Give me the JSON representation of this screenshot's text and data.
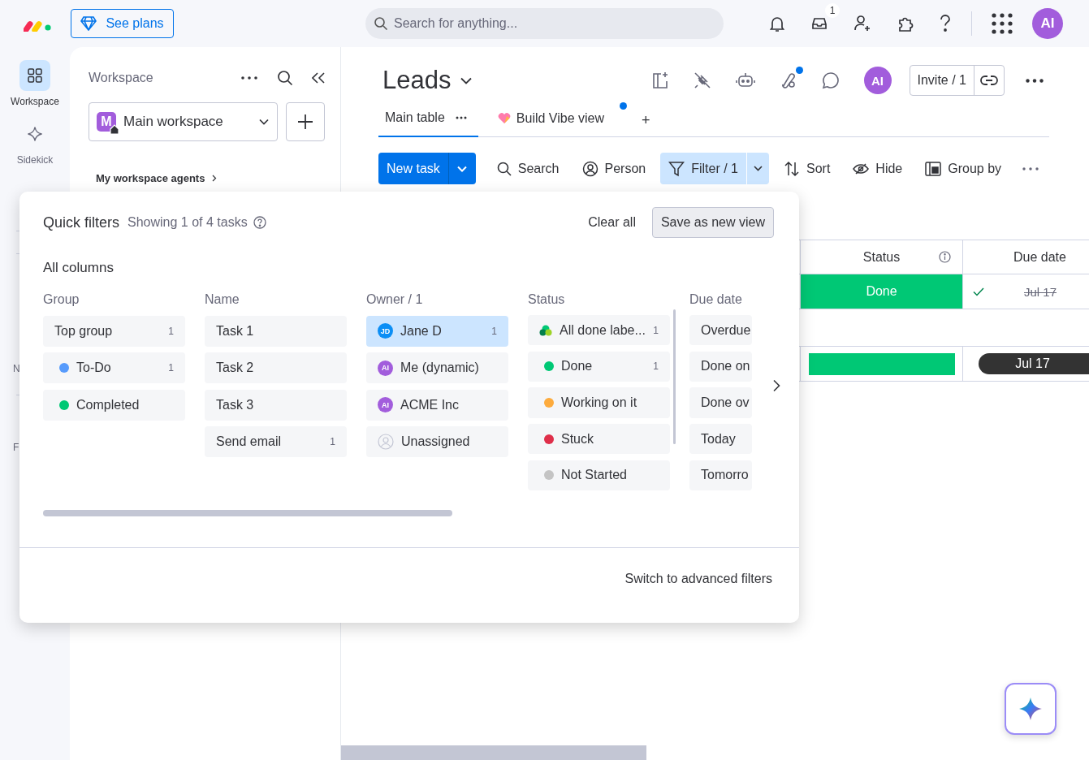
{
  "top_bar": {
    "plans_button": "See plans",
    "search": {
      "placeholder": "Search for anything..."
    },
    "inbox_badge": "1",
    "avatar": "AI"
  },
  "rail": {
    "items": [
      {
        "label": "Workspace",
        "kind": "workspace",
        "selected": true
      },
      {
        "label": "Sidekick",
        "kind": "sidekick",
        "selected": false
      }
    ],
    "cut_labels": [
      "N",
      "F"
    ]
  },
  "workspace_panel": {
    "title": "Workspace",
    "workspace": {
      "initial": "M",
      "name": "Main workspace"
    },
    "agents_link": "My workspace agents"
  },
  "board": {
    "title": "Leads",
    "avatar": "AI",
    "invite": "Invite / 1",
    "tabs": [
      {
        "label": "Main table",
        "selected": true,
        "new": false
      },
      {
        "label": "Build Vibe view",
        "selected": false,
        "new": true
      }
    ],
    "add_tab": "+",
    "toolbar": {
      "new_task": "New task",
      "items": [
        {
          "label": "Search",
          "kind": "search",
          "active": false
        },
        {
          "label": "Person",
          "kind": "person",
          "active": false
        },
        {
          "label": "Filter / 1",
          "kind": "filter",
          "active": true
        },
        {
          "label": "Sort",
          "kind": "sort",
          "active": false
        },
        {
          "label": "Hide",
          "kind": "hide",
          "active": false
        },
        {
          "label": "Group by",
          "kind": "group",
          "active": false
        }
      ]
    },
    "table": {
      "columns": [
        "Status",
        "Due date"
      ],
      "rows": [
        {
          "status": "Done",
          "color": "#00c875",
          "due": "Jul 17",
          "done": true
        }
      ],
      "summary": {
        "color": "#00c875",
        "due": "Jul 17"
      }
    }
  },
  "quick_filters": {
    "title": "Quick filters",
    "subtitle": "Showing 1 of 4 tasks",
    "clear": "Clear all",
    "save": "Save as new view",
    "section": "All columns",
    "columns": [
      {
        "heading": "Group",
        "options": [
          {
            "label": "Top group",
            "kind": "plain",
            "count": "1",
            "selected": false
          },
          {
            "label": "To-Do",
            "kind": "dot",
            "color": "#579bfc",
            "count": "1",
            "selected": false
          },
          {
            "label": "Completed",
            "kind": "dot",
            "color": "#00c875",
            "selected": false
          }
        ]
      },
      {
        "heading": "Name",
        "options": [
          {
            "label": "Task 1",
            "kind": "plain",
            "selected": false
          },
          {
            "label": "Task 2",
            "kind": "plain",
            "selected": false
          },
          {
            "label": "Task 3",
            "kind": "plain",
            "selected": false
          },
          {
            "label": "Send email",
            "kind": "plain",
            "count": "1",
            "selected": false
          }
        ]
      },
      {
        "heading": "Owner / 1",
        "options": [
          {
            "label": "Jane D",
            "kind": "avatar",
            "initials": "JD",
            "color": "#0b8ef5",
            "count": "1",
            "selected": true
          },
          {
            "label": "Me (dynamic)",
            "kind": "avatar",
            "initials": "AI",
            "color": "#a25ddc",
            "selected": false
          },
          {
            "label": "ACME Inc",
            "kind": "avatar",
            "initials": "AI",
            "color": "#a25ddc",
            "selected": false
          },
          {
            "label": "Unassigned",
            "kind": "unassigned",
            "selected": false
          }
        ]
      },
      {
        "heading": "Status",
        "options": [
          {
            "label": "All done labe...",
            "kind": "multi",
            "count": "1",
            "selected": false
          },
          {
            "label": "Done",
            "kind": "dot",
            "color": "#00c875",
            "count": "1",
            "selected": false
          },
          {
            "label": "Working on it",
            "kind": "dot",
            "color": "#fdab3d",
            "selected": false
          },
          {
            "label": "Stuck",
            "kind": "dot",
            "color": "#df2f4a",
            "selected": false
          },
          {
            "label": "Not Started",
            "kind": "dot",
            "color": "#c4c4c4",
            "selected": false
          }
        ]
      },
      {
        "heading": "Due date",
        "options": [
          {
            "label": "Overdue",
            "kind": "plain",
            "selected": false
          },
          {
            "label": "Done on",
            "kind": "plain",
            "selected": false
          },
          {
            "label": "Done ov",
            "kind": "plain",
            "selected": false
          },
          {
            "label": "Today",
            "kind": "plain",
            "selected": false
          },
          {
            "label": "Tomorro",
            "kind": "plain",
            "selected": false
          }
        ]
      }
    ],
    "footer": "Switch to advanced filters"
  }
}
